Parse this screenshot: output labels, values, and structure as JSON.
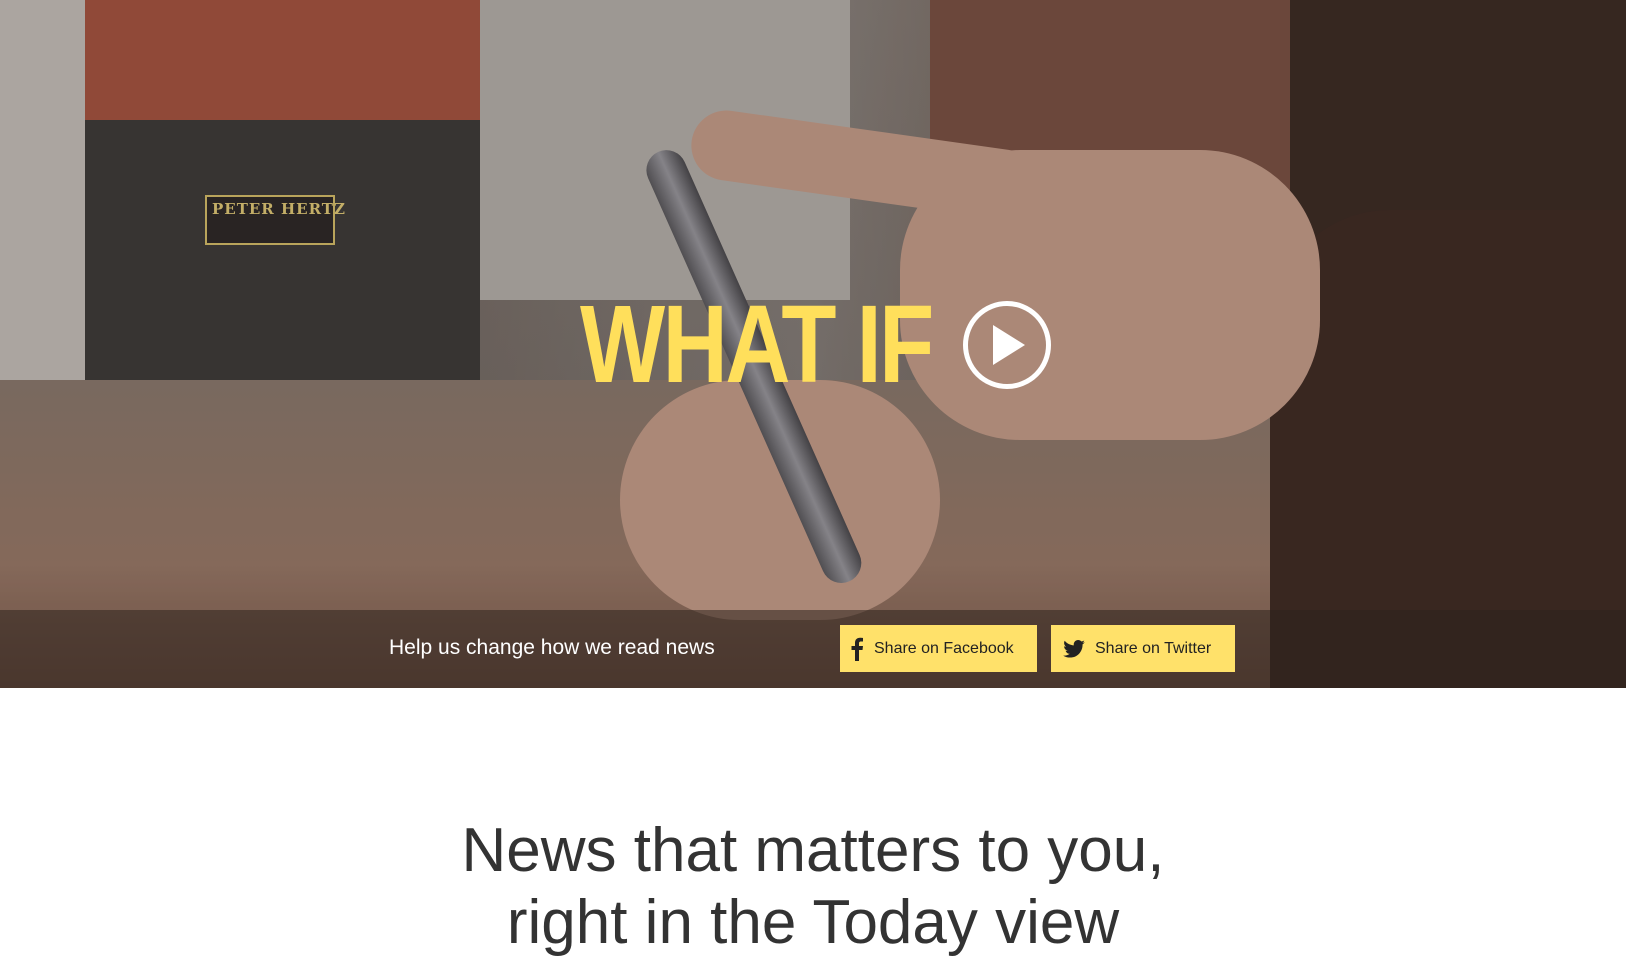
{
  "hero": {
    "title": "WHAT IF",
    "play_icon": "play-icon",
    "tagline": "Help us change how we read news",
    "storefront_sign": "PETER HERTZ",
    "share": {
      "facebook_label": "Share on Facebook",
      "facebook_icon": "facebook-icon",
      "twitter_label": "Share on Twitter",
      "twitter_icon": "twitter-icon"
    }
  },
  "content": {
    "headline_line1": "News that matters to you,",
    "headline_line2": "right in the Today view"
  },
  "colors": {
    "accent": "#ffdf5b",
    "button": "#ffe16a",
    "text_dark": "#333333"
  }
}
